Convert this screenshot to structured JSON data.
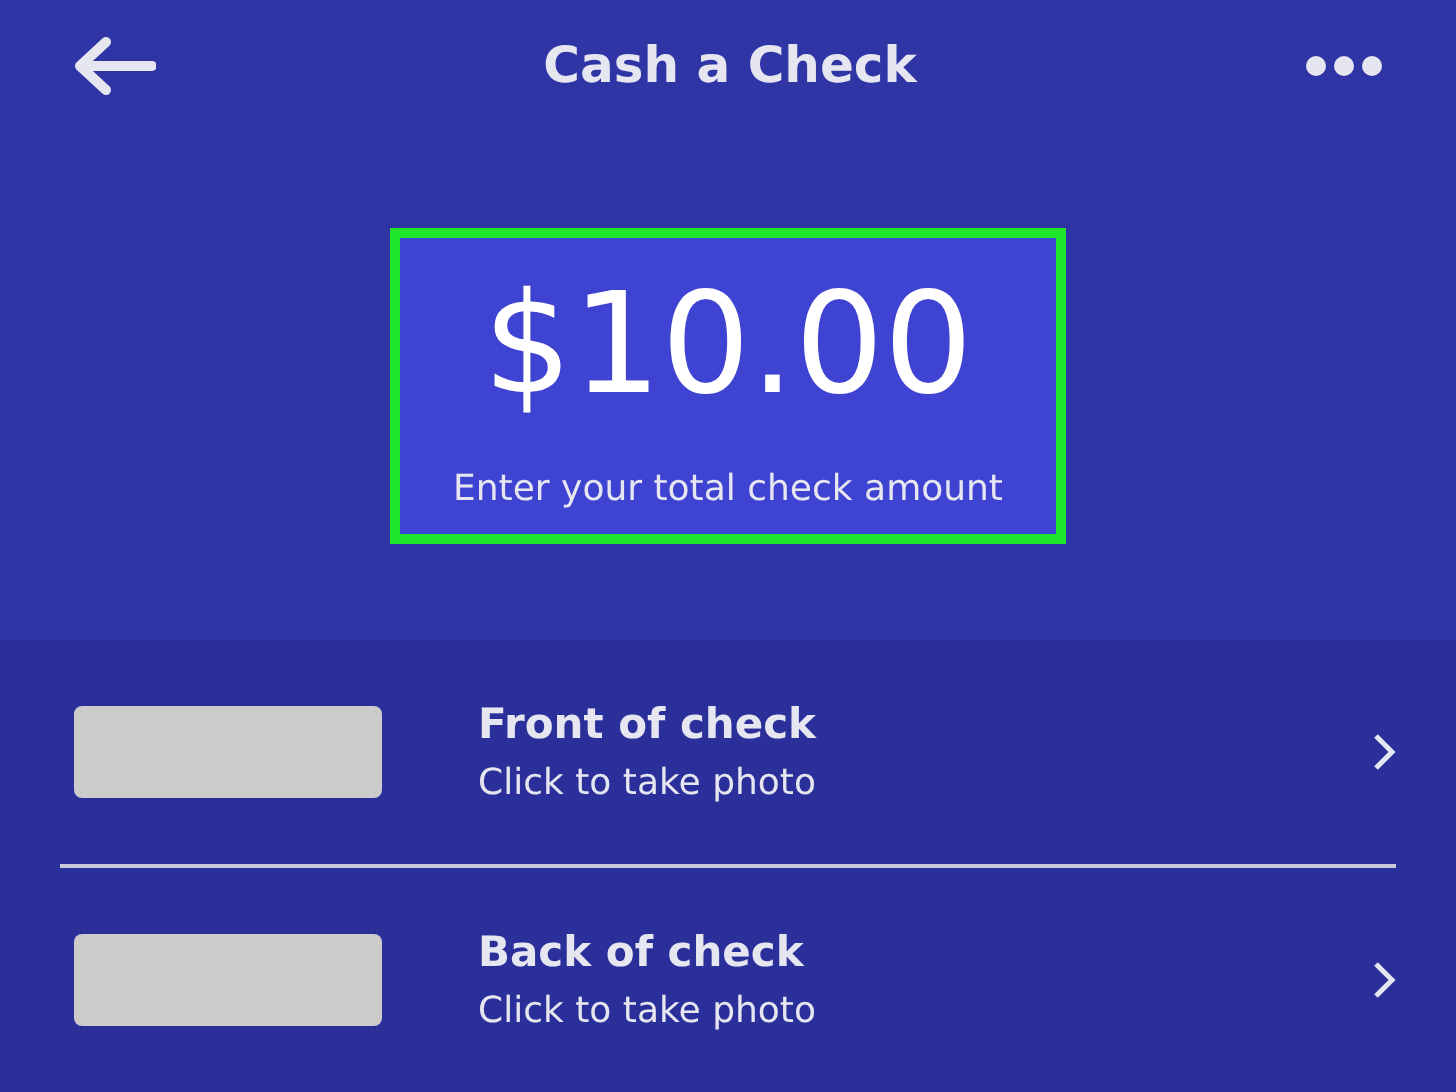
{
  "header": {
    "title": "Cash a Check"
  },
  "amount": {
    "value": "$10.00",
    "hint": "Enter your total check amount"
  },
  "rows": [
    {
      "title": "Front of check",
      "subtitle": "Click to take photo"
    },
    {
      "title": "Back of check",
      "subtitle": "Click to take photo"
    }
  ]
}
